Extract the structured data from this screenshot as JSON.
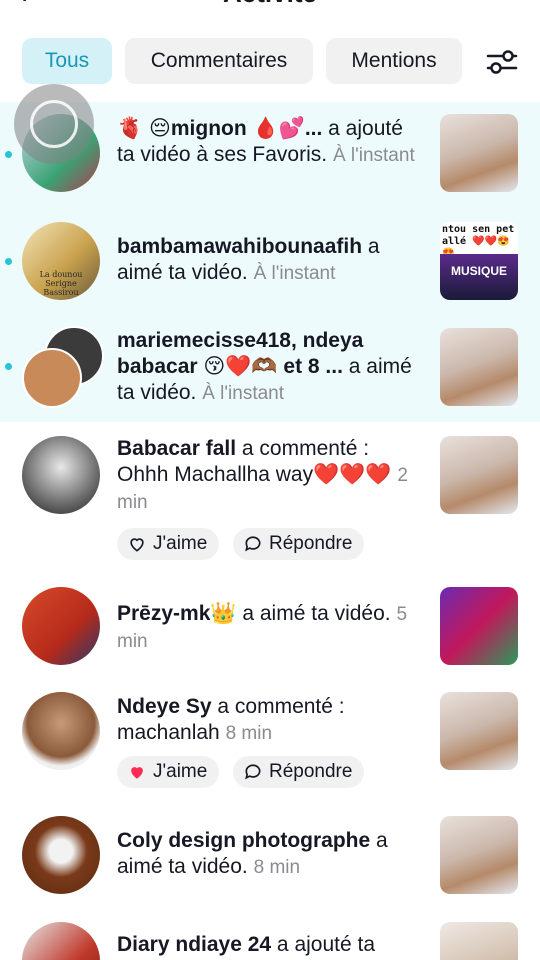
{
  "header": {
    "title": "Activité"
  },
  "tabs": [
    {
      "label": "Tous",
      "active": true
    },
    {
      "label": "Commentaires",
      "active": false
    },
    {
      "label": "Mentions",
      "active": false
    }
  ],
  "colors": {
    "accent": "#25c4d6",
    "active_tab_bg": "#d5f1f8",
    "active_tab_text": "#1a97b2",
    "unread_bg": "#eefbfd",
    "like_red": "#fe2c55"
  },
  "notifications": [
    {
      "user": "🫀 😔mignon 🩸💕...",
      "action": " a ajouté ta vidéo à ses Favoris.",
      "time": "À l'instant",
      "unread": true,
      "thumb_text": ""
    },
    {
      "user": "bambamawahibounaafih",
      "action": " a aimé ta vidéo.",
      "time": "À l'instant",
      "unread": true,
      "avatar_caption": "La dounou Serigne Bassirou",
      "thumb_text": "ntou sen pet allé ❤️❤️😍😍",
      "thumb_brand": "MUSIQUE"
    },
    {
      "user": "mariemecisse418, ndeya babacar 😚❤️🫶🏾 et 8 ...",
      "action": " a aimé ta vidéo.",
      "time": "À l'instant",
      "unread": true
    },
    {
      "user": "Babacar fall",
      "action": " a commenté : Ohhh Machallha way❤️❤️❤️",
      "time": "2 min",
      "unread": false,
      "like_label": "J'aime",
      "reply_label": "Répondre"
    },
    {
      "user": "Prēzy-mk👑",
      "action": " a aimé ta vidéo.",
      "time": "5 min",
      "unread": false
    },
    {
      "user": "Ndeye Sy",
      "action": " a commenté : machanlah",
      "time": "8 min",
      "unread": false,
      "like_label": "J'aime",
      "reply_label": "Répondre"
    },
    {
      "user": "Coly design photographe",
      "action": " a aimé ta vidéo.",
      "time": "8 min",
      "unread": false
    },
    {
      "user": "Diary ndiaye 24",
      "action": " a ajouté ta",
      "time": "",
      "unread": false
    }
  ]
}
